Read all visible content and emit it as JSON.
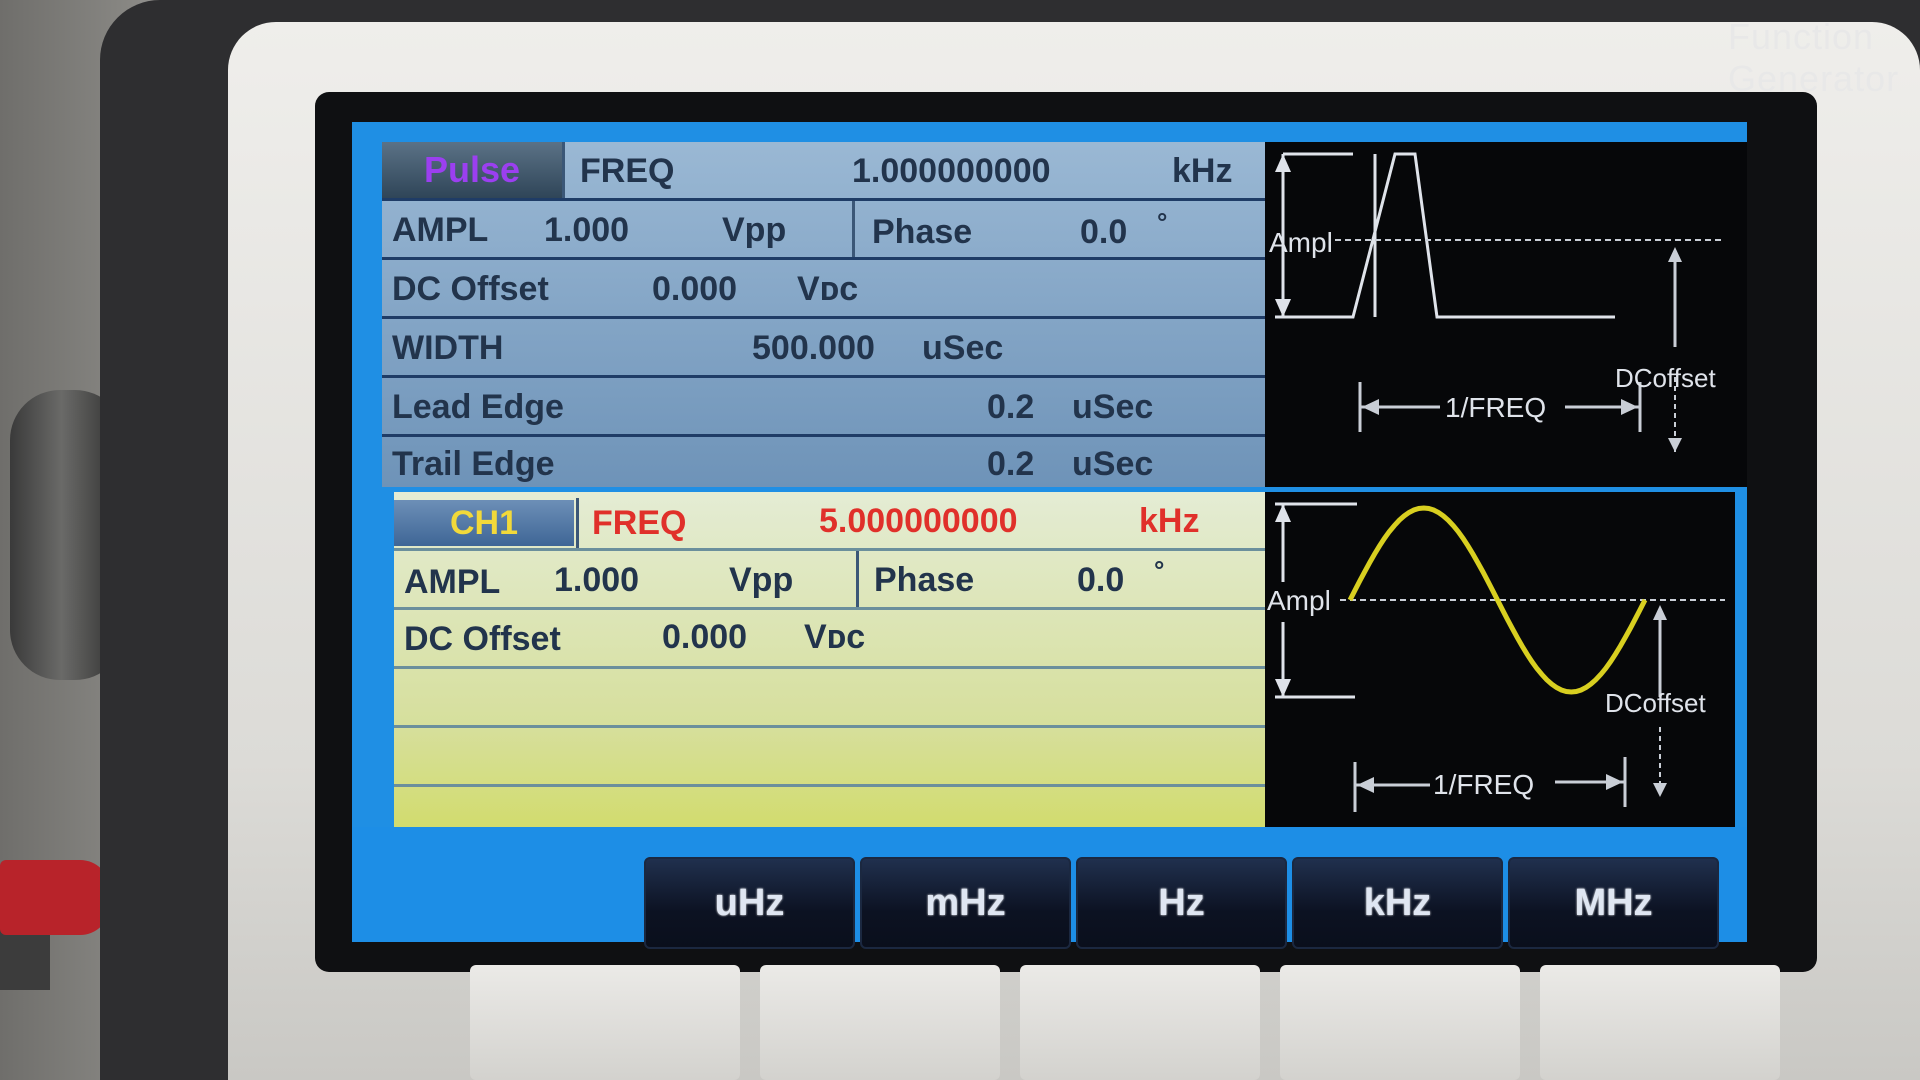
{
  "brand": "Function  Generator",
  "pulse_panel": {
    "tab_label": "Pulse",
    "freq_label": "FREQ",
    "freq_value": "1.000000000",
    "freq_unit": "kHz",
    "ampl_label": "AMPL",
    "ampl_value": "1.000",
    "ampl_unit": "Vpp",
    "phase_label": "Phase",
    "phase_value": "0.0",
    "phase_unit": "°",
    "dc_label": "DC Offset",
    "dc_value": "0.000",
    "dc_unit": "Vᴅᴄ",
    "width_label": "WIDTH",
    "width_value": "500.000",
    "width_unit": "uSec",
    "lead_label": "Lead Edge",
    "lead_value": "0.2",
    "lead_unit": "uSec",
    "trail_label": "Trail Edge",
    "trail_value": "0.2",
    "trail_unit": "uSec"
  },
  "ch1_panel": {
    "tab_label": "CH1",
    "freq_label": "FREQ",
    "freq_value": "5.000000000",
    "freq_unit": "kHz",
    "ampl_label": "AMPL",
    "ampl_value": "1.000",
    "ampl_unit": "Vpp",
    "phase_label": "Phase",
    "phase_value": "0.0",
    "phase_unit": "°",
    "dc_label": "DC Offset",
    "dc_value": "0.000",
    "dc_unit": "Vᴅᴄ"
  },
  "diagram_top": {
    "ampl": "Ampl",
    "dcoffset": "DCoffset",
    "period": "1/FREQ"
  },
  "diagram_bottom": {
    "ampl": "Ampl",
    "dcoffset": "DCoffset",
    "period": "1/FREQ"
  },
  "softkeys": [
    "uHz",
    "mHz",
    "Hz",
    "kHz",
    "MHz"
  ],
  "colors": {
    "screen_blue": "#1f8fe4",
    "ch1_freq_red": "#e0302a",
    "pulse_tab_purple": "#9b3ff0",
    "ch1_tab_yellow": "#f2d93a",
    "sine_yellow": "#d8cf20"
  }
}
